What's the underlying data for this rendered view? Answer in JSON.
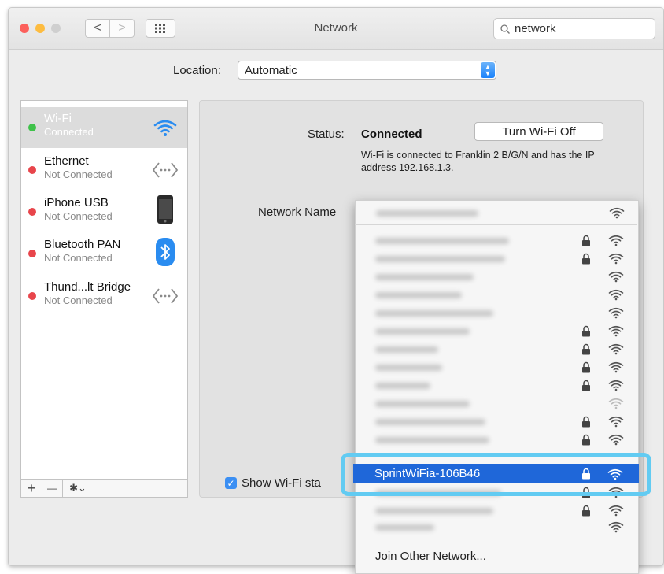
{
  "window": {
    "title": "Network"
  },
  "toolbar": {
    "search_value": "network",
    "back": "<",
    "forward": ">"
  },
  "location": {
    "label": "Location:",
    "value": "Automatic"
  },
  "services": [
    {
      "name": "Wi-Fi",
      "status": "Connected",
      "state": "green",
      "icon": "wifi-icon",
      "selected": true
    },
    {
      "name": "Ethernet",
      "status": "Not Connected",
      "state": "red",
      "icon": "ethernet-arrows-icon"
    },
    {
      "name": "iPhone USB",
      "status": "Not Connected",
      "state": "red",
      "icon": "iphone-icon"
    },
    {
      "name": "Bluetooth PAN",
      "status": "Not Connected",
      "state": "red",
      "icon": "bluetooth-icon"
    },
    {
      "name": "Thund...lt Bridge",
      "status": "Not Connected",
      "state": "red",
      "icon": "ethernet-arrows-icon"
    }
  ],
  "sidebar_buttons": {
    "add": "+",
    "remove": "—",
    "action": "✱⌄"
  },
  "status": {
    "label": "Status:",
    "value": "Connected",
    "description": "Wi-Fi is connected to Franklin 2 B/G/N and has the IP address 192.168.1.3.",
    "turn_off_label": "Turn Wi-Fi Off"
  },
  "network_name": {
    "label": "Network Name"
  },
  "show_wifi": {
    "label": "Show Wi-Fi sta",
    "checked": true
  },
  "networks": {
    "selected": "SprintWiFia-106B46",
    "join_other": "Join Other Network..."
  },
  "colors": {
    "accent": "#1f67d9",
    "highlight": "#62cbf2",
    "green": "#3fc24a",
    "red": "#e8454b",
    "wifi_blue": "#2a8cf0"
  }
}
